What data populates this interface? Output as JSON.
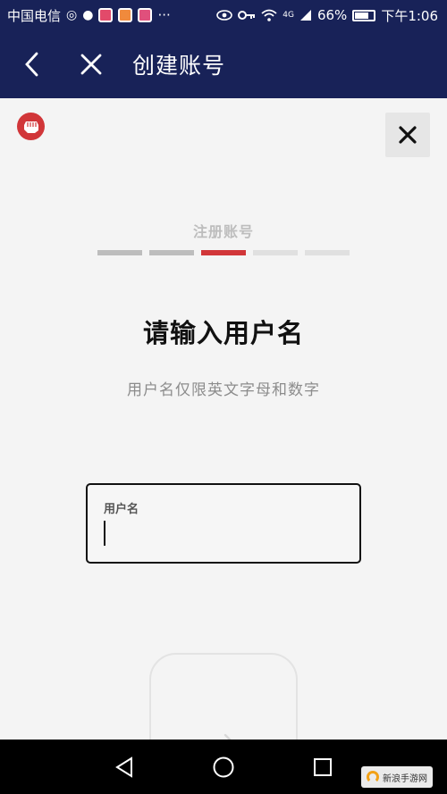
{
  "status_bar": {
    "carrier": "中国电信",
    "battery": "66%",
    "network": "4G",
    "time": "下午1:06",
    "more": "···"
  },
  "nav": {
    "title": "创建账号"
  },
  "signup": {
    "step_label": "注册账号",
    "current_step": 3,
    "total_steps": 5,
    "heading": "请输入用户名",
    "subheading": "用户名仅限英文字母和数字",
    "username_label": "用户名",
    "username_value": ""
  },
  "watermark": {
    "text": "新浪手游网"
  },
  "colors": {
    "header_bg": "#182258",
    "accent": "#d13639",
    "page_bg": "#f4f4f4"
  },
  "icons": [
    "back-icon",
    "close-icon",
    "riot-fist-logo",
    "arrow-right-icon",
    "triangle-back-icon",
    "circle-home-icon",
    "square-recent-icon"
  ]
}
